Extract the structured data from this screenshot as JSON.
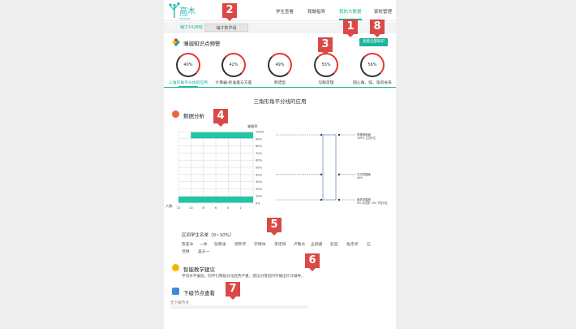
{
  "brand": {
    "cn": "高木",
    "en": "GAOMU WISDOM"
  },
  "nav": [
    {
      "label": "学生查看"
    },
    {
      "label": "我做指导"
    },
    {
      "label": "我的大数据"
    },
    {
      "label": "家校管理"
    }
  ],
  "tabs": {
    "active_label": "辅才1428班",
    "inactive_label": "辅才数学组"
  },
  "warning": {
    "title": "薄弱知识点预警",
    "view_all_label": "查看全部知识",
    "knowledge_points": [
      {
        "percent": "40%",
        "name": "三角形角平分线的应用"
      },
      {
        "percent": "42%",
        "name": "计算器-标准差与方差"
      },
      {
        "percent": "49%",
        "name": "频谱型"
      },
      {
        "percent": "55%",
        "name": "勾股定理"
      },
      {
        "percent": "56%",
        "name": "圆心角、弧、弦的关系"
      }
    ]
  },
  "detail_title": "三角形角平分线的应用",
  "data_analysis": {
    "title": "数据分析",
    "chart_data": {
      "type": "bar",
      "orientation": "horizontal",
      "title": "",
      "xlabel": "人数",
      "ylabel": "掌握率",
      "x_ticks": [
        "12",
        "10",
        "8",
        "6",
        "4",
        "2"
      ],
      "y_ticks": [
        "100%",
        "90%",
        "80%",
        "70%",
        "60%",
        "50%",
        "40%",
        "30%",
        "20%",
        "10%",
        "0%"
      ],
      "bars": [
        {
          "bin": "90%-100%",
          "value": 10
        },
        {
          "bin": "0%-10%",
          "value": 12
        }
      ],
      "grid": true
    },
    "markers": [
      {
        "label": "掌握程度最",
        "sublabel": "100% 上四分位"
      },
      {
        "label": "平均掌握度",
        "sublabel": "40%"
      },
      {
        "label": "最低掌握度",
        "sublabel": "0% 中位数 / 0% 下四分位"
      }
    ]
  },
  "students": {
    "label": "区间学生名单（0~10%）",
    "names": [
      "陈奕冰",
      "一休",
      "张霖涛",
      "郭昕宇",
      "邓博林",
      "李佳琦",
      "卢敬水",
      "孟婉睿",
      "彭昊",
      "詹佳祁",
      "石",
      "佳琳",
      "吴天一"
    ]
  },
  "advice": {
    "title": "智能教学建议",
    "text": "平均水平偏低，同学们两极分化趋势严重，建议对落后同学做出针对辅导。"
  },
  "next": {
    "title": "下级节点查看",
    "empty_text": "无下级节点"
  },
  "callouts": [
    "1",
    "2",
    "3",
    "4",
    "5",
    "6",
    "7",
    "8"
  ],
  "colors": {
    "accent": "#1fb39c",
    "bar": "#22c4a5",
    "ring_warn": "#e53935",
    "callout": "#d94a47"
  }
}
